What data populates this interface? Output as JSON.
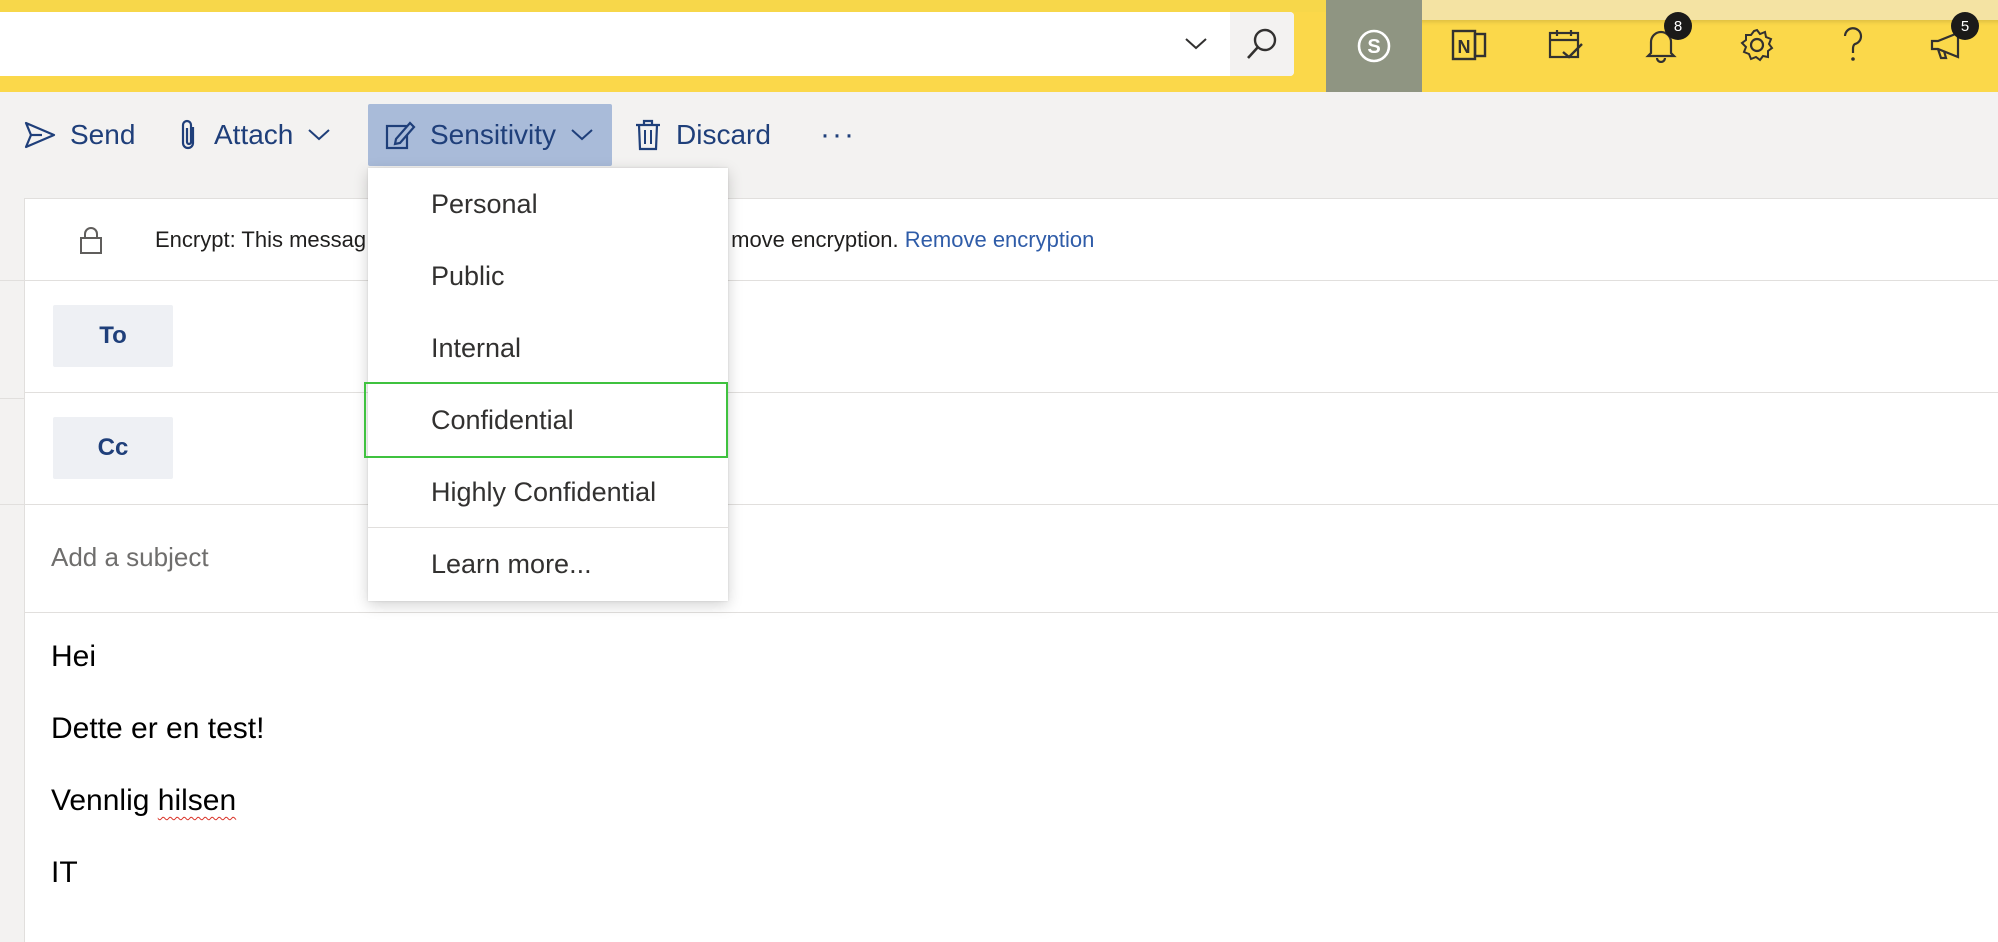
{
  "search": {
    "placeholder": "",
    "value": ""
  },
  "header_icons": {
    "notifications_count": "8",
    "feedback_count": "5"
  },
  "toolbar": {
    "send_label": "Send",
    "attach_label": "Attach",
    "sensitivity_label": "Sensitivity",
    "discard_label": "Discard",
    "more_label": "···"
  },
  "sensitivity_menu": {
    "items": [
      "Personal",
      "Public",
      "Internal",
      "Confidential",
      "Highly Confidential"
    ],
    "focused_item": "Confidential",
    "learn_more": "Learn more...",
    "focus_color": "#3fc23f"
  },
  "compose": {
    "encrypt_before": "Encrypt: This messag",
    "encrypt_after": "move encryption.",
    "remove_encryption_link": "Remove encryption",
    "to_label": "To",
    "cc_label": "Cc",
    "subject_placeholder": "Add a subject",
    "body": {
      "line1": "Hei",
      "line2": "Dette er en test!",
      "line3_a": "Vennlig ",
      "line3_b": "hilsen",
      "line4": "IT"
    }
  },
  "colors": {
    "accent_yellow": "#fbd84a",
    "command_text": "#1f3f7a",
    "active_button": "#a9bbd9",
    "link": "#2f5ca8"
  }
}
